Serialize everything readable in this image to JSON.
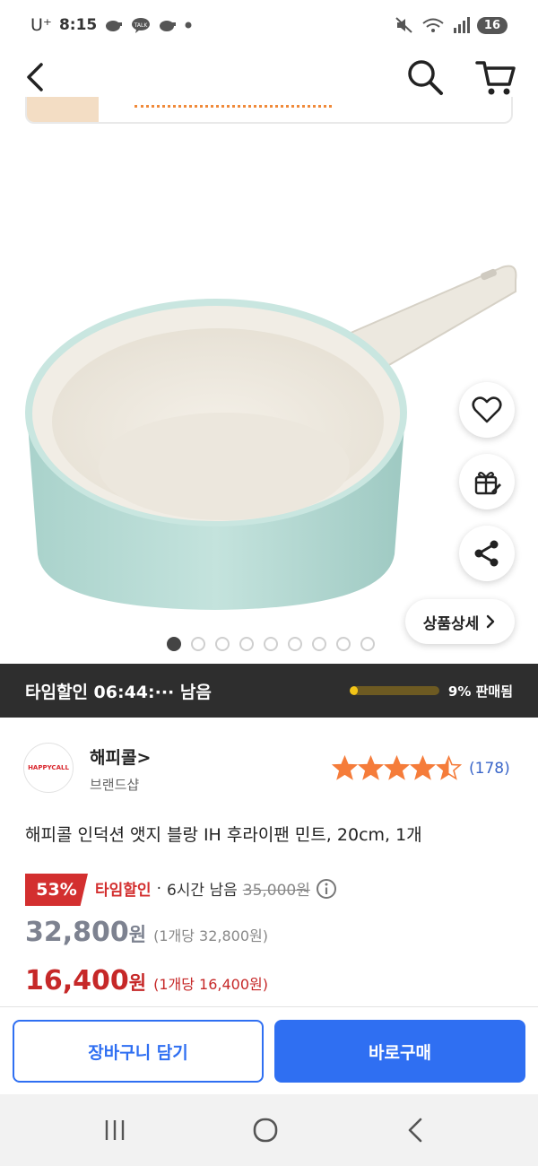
{
  "status_bar": {
    "carrier": "U⁺",
    "time": "8:15",
    "battery": "16"
  },
  "app_bar": {
    "icons": [
      "back-arrow-icon",
      "search-icon",
      "cart-icon"
    ]
  },
  "carousel": {
    "total_images": 9,
    "active_index": 0,
    "detail_button_label": "상품상세",
    "float_icons": [
      "heart-icon",
      "gift-icon",
      "share-icon"
    ]
  },
  "time_sale": {
    "label": "타임할인 06:44:··· 남음",
    "sold_fraction": 0.09,
    "sold_text": "9% 판매됨"
  },
  "brand": {
    "logo_text": "HAPPYCALL",
    "name": "해피콜>",
    "shop_label": "브랜드샵"
  },
  "rating": {
    "stars": 4.5,
    "review_count": "(178)"
  },
  "product": {
    "title": "해피콜 인덕션 앳지 블랑 IH 후라이팬 민트, 20cm, 1개"
  },
  "price": {
    "discount_rate": "53%",
    "sale_label": "타임할인",
    "separator": "·",
    "remaining": "6시간 남음",
    "original_price": "35,000원",
    "normal_price": "32,800",
    "normal_unit": "원",
    "normal_per_unit": "(1개당 32,800원)",
    "sale_price": "16,400",
    "sale_unit": "원",
    "sale_per_unit": "(1개당 16,400원)"
  },
  "actions": {
    "add_to_cart": "장바구니 담기",
    "buy_now": "바로구매"
  },
  "colors": {
    "accent_blue": "#2f6ff2",
    "sale_red": "#d32f2f",
    "star_orange": "#f57c3a",
    "timebar_bg": "#2e2e2e",
    "progress_yellow": "#f2c417",
    "pan_mint": "#b9dcd6"
  }
}
